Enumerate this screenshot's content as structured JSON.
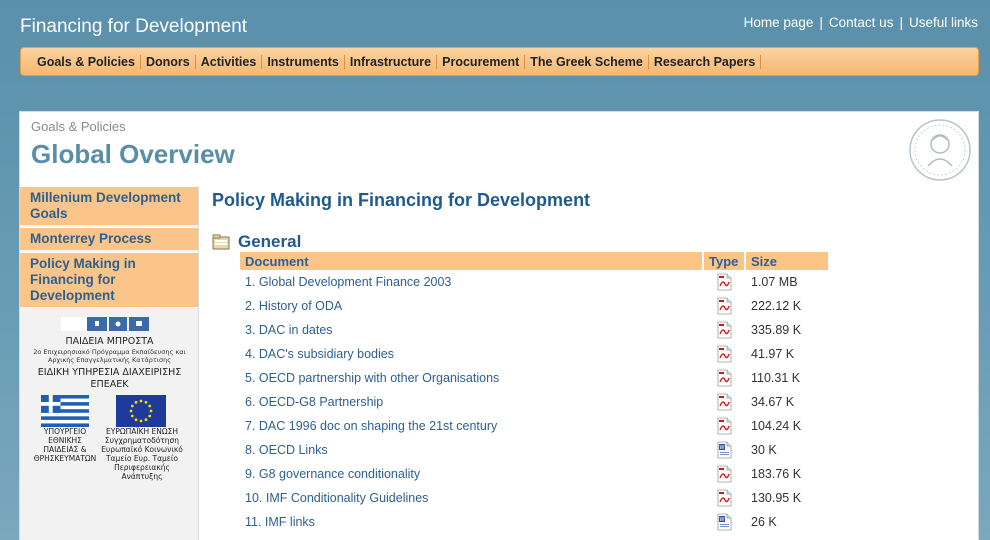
{
  "site": {
    "title": "Financing for Development",
    "links": [
      {
        "label": "Home page",
        "name": "home-page-link"
      },
      {
        "label": "Contact us",
        "name": "contact-us-link"
      },
      {
        "label": "Useful links",
        "name": "useful-links-link"
      }
    ],
    "link_separator": "|"
  },
  "nav": {
    "items": [
      {
        "label": "Goals & Policies",
        "name": "nav-goals-policies"
      },
      {
        "label": "Donors",
        "name": "nav-donors"
      },
      {
        "label": "Activities",
        "name": "nav-activities"
      },
      {
        "label": "Instruments",
        "name": "nav-instruments"
      },
      {
        "label": "Infrastructure",
        "name": "nav-infrastructure"
      },
      {
        "label": "Procurement",
        "name": "nav-procurement"
      },
      {
        "label": "The Greek Scheme",
        "name": "nav-greek-scheme"
      },
      {
        "label": "Research Papers",
        "name": "nav-research-papers"
      }
    ]
  },
  "page": {
    "breadcrumb": "Goals & Policies",
    "title": "Global Overview"
  },
  "sidebar": {
    "items": [
      {
        "label": "Millenium Development Goals",
        "name": "sidebar-item-millenium-goals"
      },
      {
        "label": "Monterrey Process",
        "name": "sidebar-item-monterrey"
      },
      {
        "label": "Policy Making in Financing for Development",
        "name": "sidebar-item-policy-making"
      }
    ],
    "logos": {
      "paideia_title": "ΠΑΙΔΕΙΑ ΜΠΡΟΣΤΑ",
      "paideia_sub": "2ο Επιχειρησιακό Πρόγραμμα Εκπαίδευσης και Αρχικής Επαγγελματικής Κατάρτισης",
      "eidiki": "ΕΙΔΙΚΗ ΥΠΗΡΕΣΙΑ ΔΙΑΧΕΙΡΙΣΗΣ ΕΠΕΑΕΚ",
      "ministry_caption": "ΥΠΟΥΡΓΕΙΟ ΕΘΝΙΚΗΣ ΠΑΙΔΕΙΑΣ & ΘΡΗΣΚΕΥΜΑΤΩΝ",
      "eu_caption": "ΕΥΡΩΠΑΪΚΗ ΕΝΩΣΗ Συγχρηματοδότηση Ευρωπαϊκό Κοινωνικό Ταμείο Ευρ. Ταμείο Περιφερειακής Ανάπτυξης"
    }
  },
  "content": {
    "heading": "Policy Making in Financing for Development",
    "section_title": "General",
    "columns": {
      "document": "Document",
      "type": "Type",
      "size": "Size"
    },
    "documents": [
      {
        "label": "1. Global Development Finance 2003",
        "type": "pdf-icon",
        "size": "1.07 MB"
      },
      {
        "label": "2. History of ODA",
        "type": "pdf-icon",
        "size": "222.12 K"
      },
      {
        "label": "3. DAC in dates",
        "type": "pdf-icon",
        "size": "335.89 K"
      },
      {
        "label": "4. DAC's subsidiary bodies",
        "type": "pdf-icon",
        "size": "41.97 K"
      },
      {
        "label": "5. OECD partnership with other Organisations",
        "type": "pdf-icon",
        "size": "110.31 K"
      },
      {
        "label": "6. OECD-G8 Partnership",
        "type": "pdf-icon",
        "size": "34.67 K"
      },
      {
        "label": "7. DAC 1996 doc on shaping the 21st century",
        "type": "pdf-icon",
        "size": "104.24 K"
      },
      {
        "label": "8. OECD Links",
        "type": "word-doc-icon",
        "size": "30 K"
      },
      {
        "label": "9. G8 governance conditionality",
        "type": "pdf-icon",
        "size": "183.76 K"
      },
      {
        "label": "10. IMF Conditionality Guidelines",
        "type": "pdf-icon",
        "size": "130.95 K"
      },
      {
        "label": "11. IMF links",
        "type": "word-doc-icon",
        "size": "26 K"
      }
    ]
  },
  "colors": {
    "background": "#6a9db5",
    "nav_orange": "#f7b870",
    "title_blue": "#5a8ea8",
    "link_blue": "#2e5f8f",
    "heading_blue": "#1e5a8f",
    "sidebar_orange": "#fbc58a"
  }
}
